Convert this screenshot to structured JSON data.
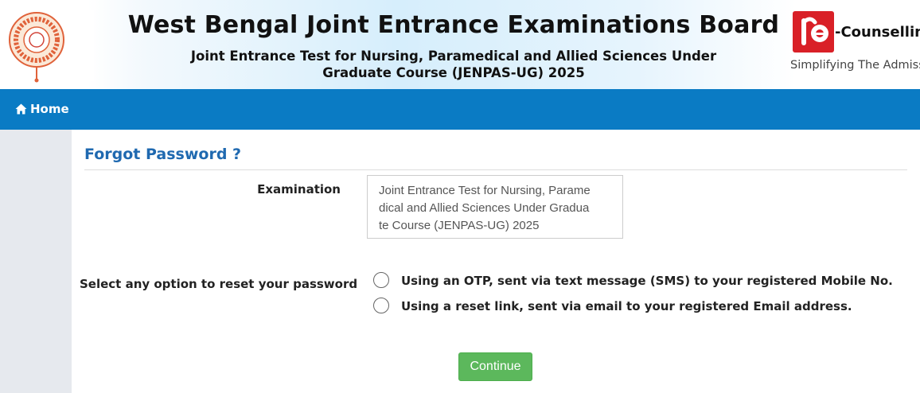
{
  "header": {
    "title": "West Bengal Joint Entrance Examinations Board",
    "subtitle": "Joint Entrance Test for Nursing, Paramedical and Allied Sciences Under Graduate Course (JENPAS-UG) 2025",
    "right_logo": {
      "brand": "-Counselling",
      "tagline": "Simplifying The Admiss"
    }
  },
  "nav": {
    "home_label": "Home"
  },
  "page": {
    "title": "Forgot Password ?",
    "examination_label": "Examination",
    "examination_value": "Joint Entrance Test for Nursing, Paramedical and Allied Sciences Under Graduate Course (JENPAS-UG) 2025",
    "reset_label": "Select any option to reset your password",
    "options": [
      {
        "label": "Using an OTP, sent via text message (SMS) to your registered Mobile No.",
        "selected": false
      },
      {
        "label": "Using a reset link, sent via email to your registered Email address.",
        "selected": false
      }
    ],
    "continue_label": "Continue"
  },
  "colors": {
    "nav_bg": "#0a7bc4",
    "title_blue": "#1f69b0",
    "button_green": "#5cb85c",
    "logo_red": "#d92027"
  },
  "icons": {
    "home": "home-icon",
    "left_logo": "wbjeeb-seal-logo",
    "right_logo": "e-counselling-logo"
  }
}
